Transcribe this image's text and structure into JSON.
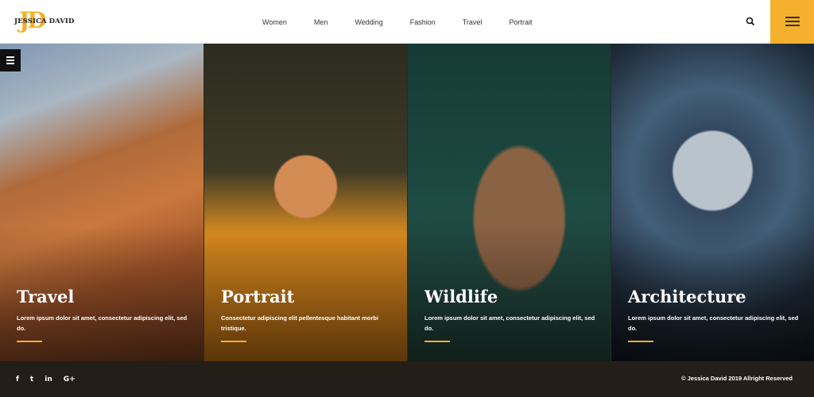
{
  "brand": {
    "monogram": "JD",
    "name": "JESSICA DAVID"
  },
  "nav": {
    "items": [
      "Women",
      "Men",
      "Wedding",
      "Fashion",
      "Travel",
      "Portrait"
    ]
  },
  "header": {
    "search_icon": "search-icon",
    "menu_icon": "hamburger-icon",
    "accent": "#f5b02e"
  },
  "panels": [
    {
      "title": "Travel",
      "text": "Lorem ipsum dolor sit amet, consectetur adipiscing elit, sed do."
    },
    {
      "title": "Portrait",
      "text": "Consectetur adipiscing elit pellentesque habitant morbi tristique."
    },
    {
      "title": "Wildlife",
      "text": "Lorem ipsum dolor sit amet, consectetur adipiscing elit, sed do."
    },
    {
      "title": "Architecture",
      "text": "Lorem ipsum dolor sit amet, consectetur adipiscing elit, sed do."
    }
  ],
  "footer": {
    "social": [
      {
        "icon": "facebook-icon",
        "label": "f"
      },
      {
        "icon": "twitter-icon",
        "label": "t"
      },
      {
        "icon": "linkedin-icon",
        "label": "in"
      },
      {
        "icon": "googleplus-icon",
        "label": "G+"
      }
    ],
    "copyright": "© Jessica David 2019 Allright Reserved"
  }
}
